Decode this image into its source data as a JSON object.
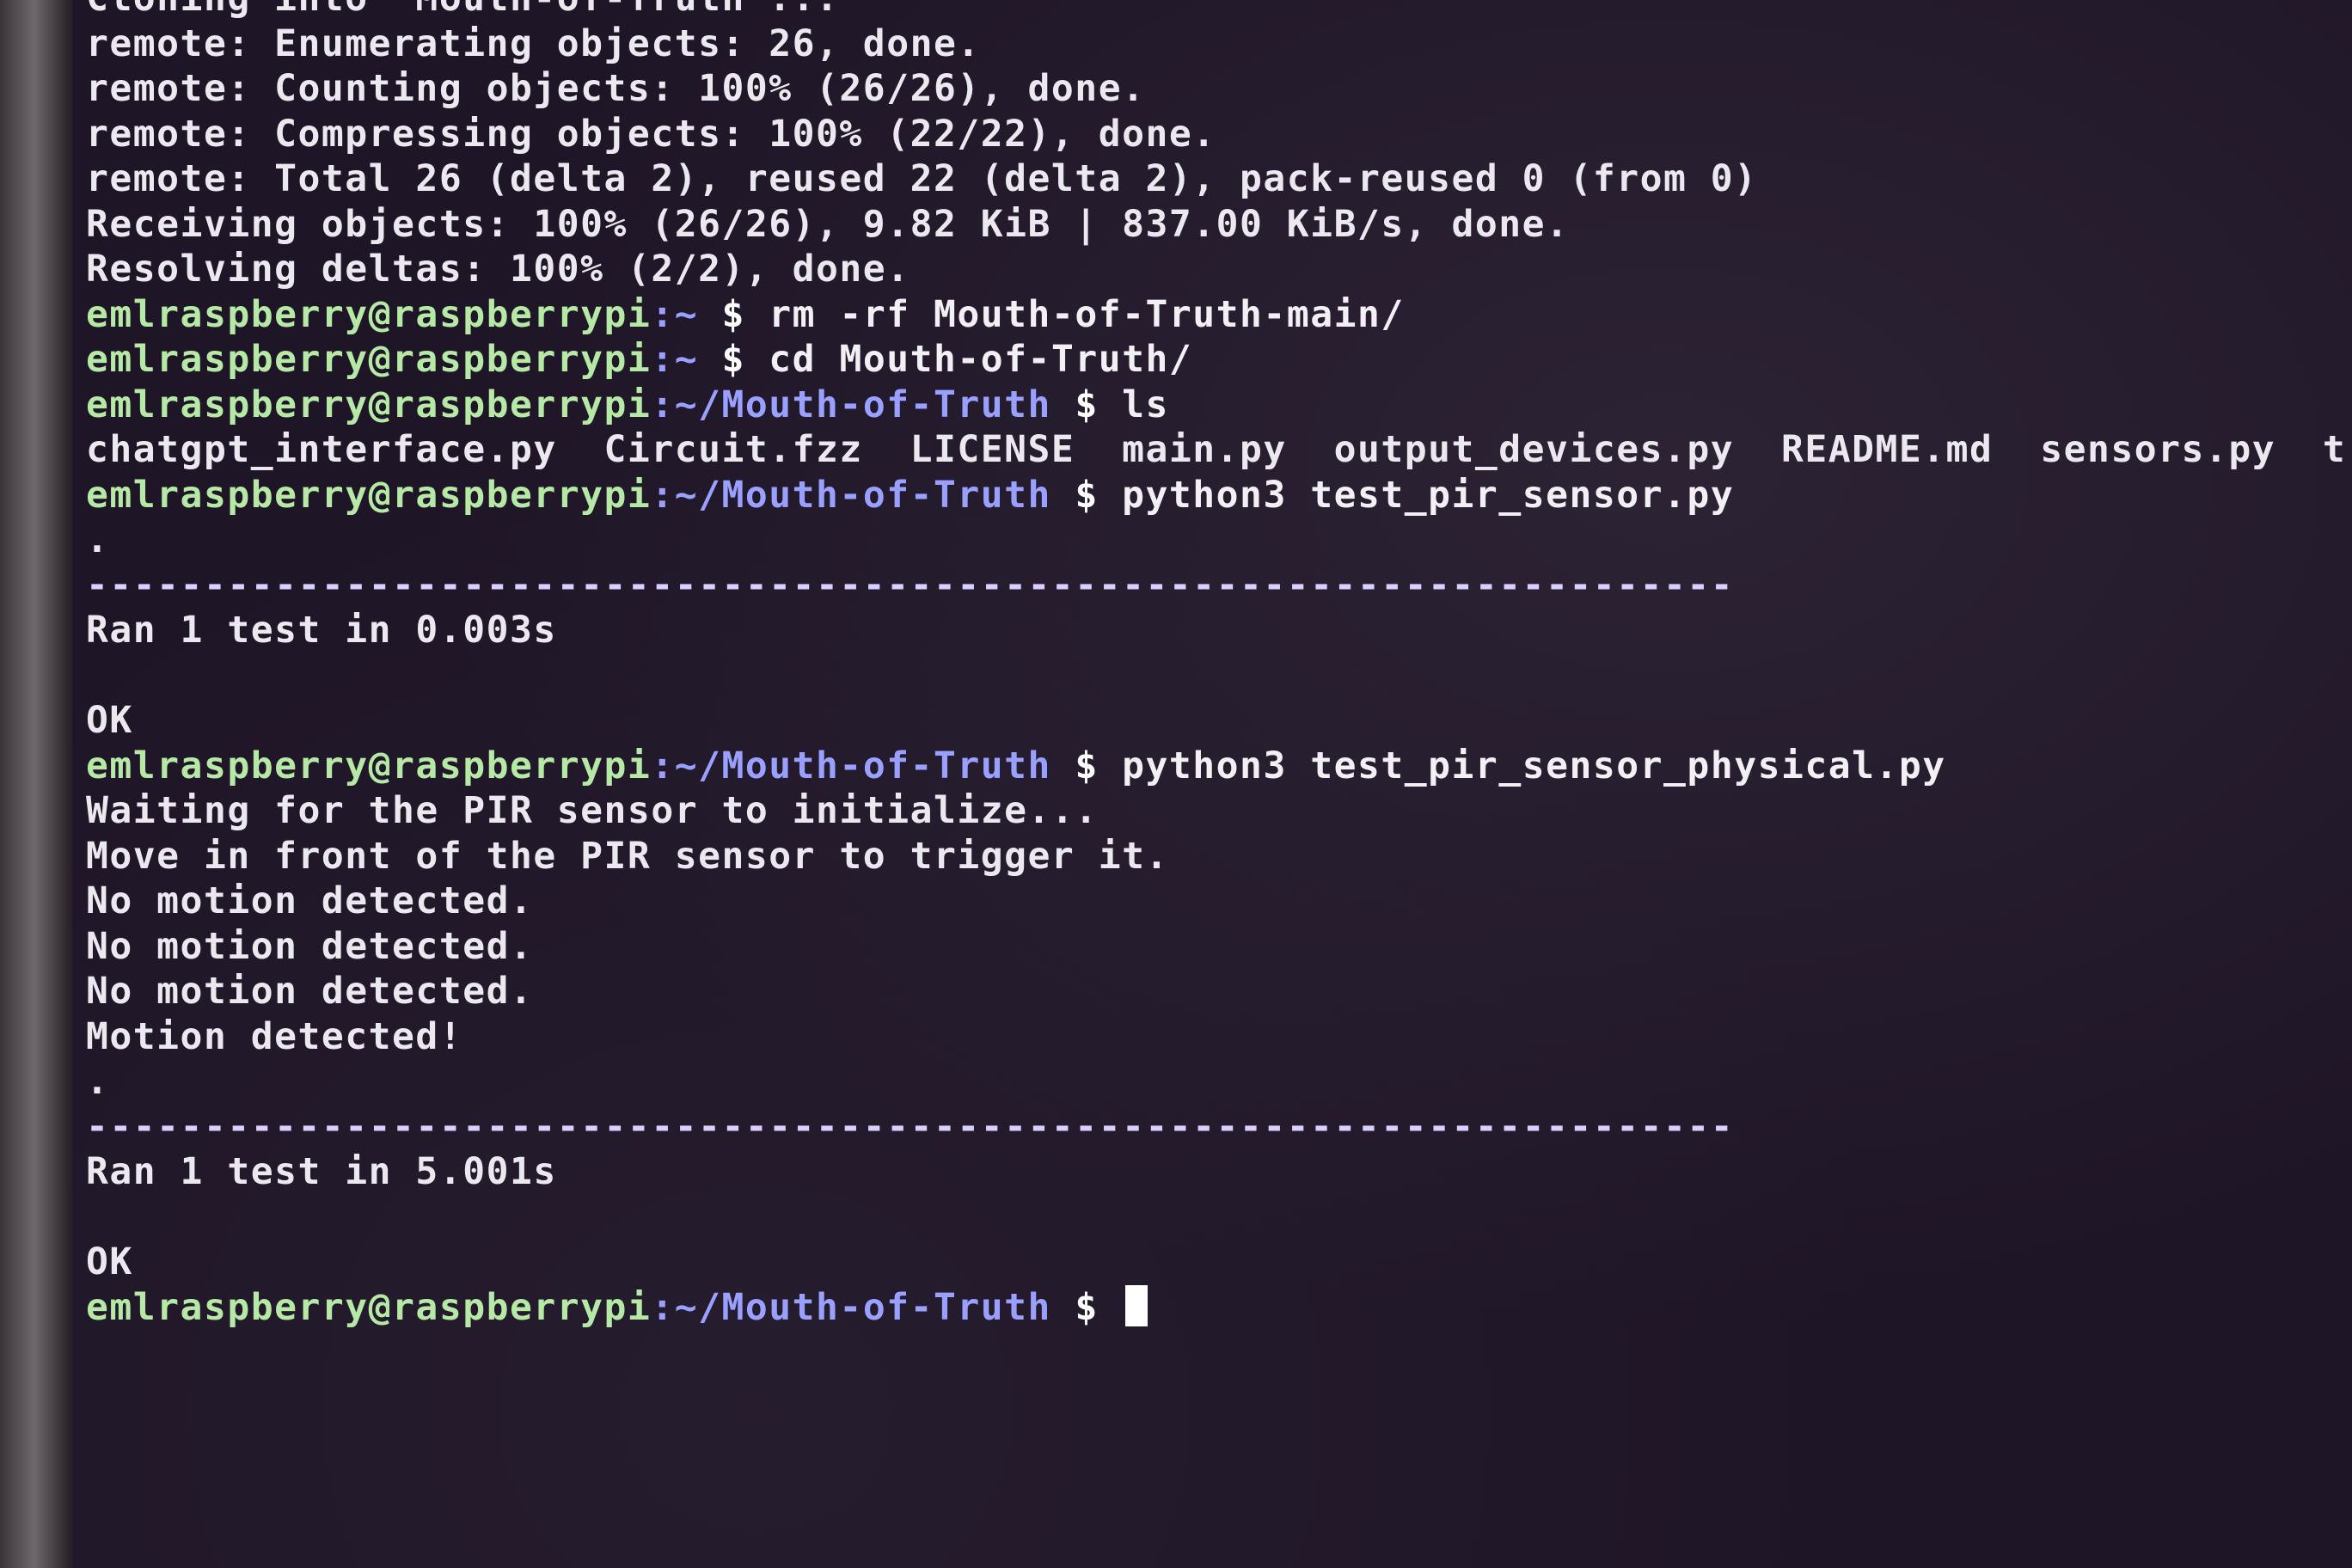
{
  "terminal": {
    "lines": [
      {
        "kind": "text",
        "text": "Cloning into 'Mouth-of-Truth'..."
      },
      {
        "kind": "text",
        "text": "remote: Enumerating objects: 26, done."
      },
      {
        "kind": "text",
        "text": "remote: Counting objects: 100% (26/26), done."
      },
      {
        "kind": "text",
        "text": "remote: Compressing objects: 100% (22/22), done."
      },
      {
        "kind": "text",
        "text": "remote: Total 26 (delta 2), reused 22 (delta 2), pack-reused 0 (from 0)"
      },
      {
        "kind": "text",
        "text": "Receiving objects: 100% (26/26), 9.82 KiB | 837.00 KiB/s, done."
      },
      {
        "kind": "text",
        "text": "Resolving deltas: 100% (2/2), done."
      },
      {
        "kind": "prompt",
        "user": "emlraspberry@raspberrypi",
        "path": ":~",
        "sign": " $ ",
        "cmd": "rm -rf Mouth-of-Truth-main/"
      },
      {
        "kind": "prompt",
        "user": "emlraspberry@raspberrypi",
        "path": ":~",
        "sign": " $ ",
        "cmd": "cd Mouth-of-Truth/"
      },
      {
        "kind": "prompt",
        "user": "emlraspberry@raspberrypi",
        "path": ":~/Mouth-of-Truth",
        "sign": " $ ",
        "cmd": "ls"
      },
      {
        "kind": "text",
        "text": "chatgpt_interface.py  Circuit.fzz  LICENSE  main.py  output_devices.py  README.md  sensors.py  t"
      },
      {
        "kind": "prompt",
        "user": "emlraspberry@raspberrypi",
        "path": ":~/Mouth-of-Truth",
        "sign": " $ ",
        "cmd": "python3 test_pir_sensor.py"
      },
      {
        "kind": "text",
        "text": "."
      },
      {
        "kind": "dash",
        "text": "----------------------------------------------------------------------"
      },
      {
        "kind": "text",
        "text": "Ran 1 test in 0.003s"
      },
      {
        "kind": "text",
        "text": ""
      },
      {
        "kind": "text",
        "text": "OK"
      },
      {
        "kind": "prompt",
        "user": "emlraspberry@raspberrypi",
        "path": ":~/Mouth-of-Truth",
        "sign": " $ ",
        "cmd": "python3 test_pir_sensor_physical.py"
      },
      {
        "kind": "text",
        "text": "Waiting for the PIR sensor to initialize..."
      },
      {
        "kind": "text",
        "text": "Move in front of the PIR sensor to trigger it."
      },
      {
        "kind": "text",
        "text": "No motion detected."
      },
      {
        "kind": "text",
        "text": "No motion detected."
      },
      {
        "kind": "text",
        "text": "No motion detected."
      },
      {
        "kind": "text",
        "text": "Motion detected!"
      },
      {
        "kind": "text",
        "text": "."
      },
      {
        "kind": "dash",
        "text": "----------------------------------------------------------------------"
      },
      {
        "kind": "text",
        "text": "Ran 1 test in 5.001s"
      },
      {
        "kind": "text",
        "text": ""
      },
      {
        "kind": "text",
        "text": "OK"
      },
      {
        "kind": "prompt",
        "user": "emlraspberry@raspberrypi",
        "path": ":~/Mouth-of-Truth",
        "sign": " $ ",
        "cmd": "",
        "cursor": true
      }
    ]
  },
  "colors": {
    "background": "#1e1526",
    "prompt_user": "#b6e8a6",
    "prompt_path": "#9aa0ff",
    "text": "#ece8f0"
  }
}
